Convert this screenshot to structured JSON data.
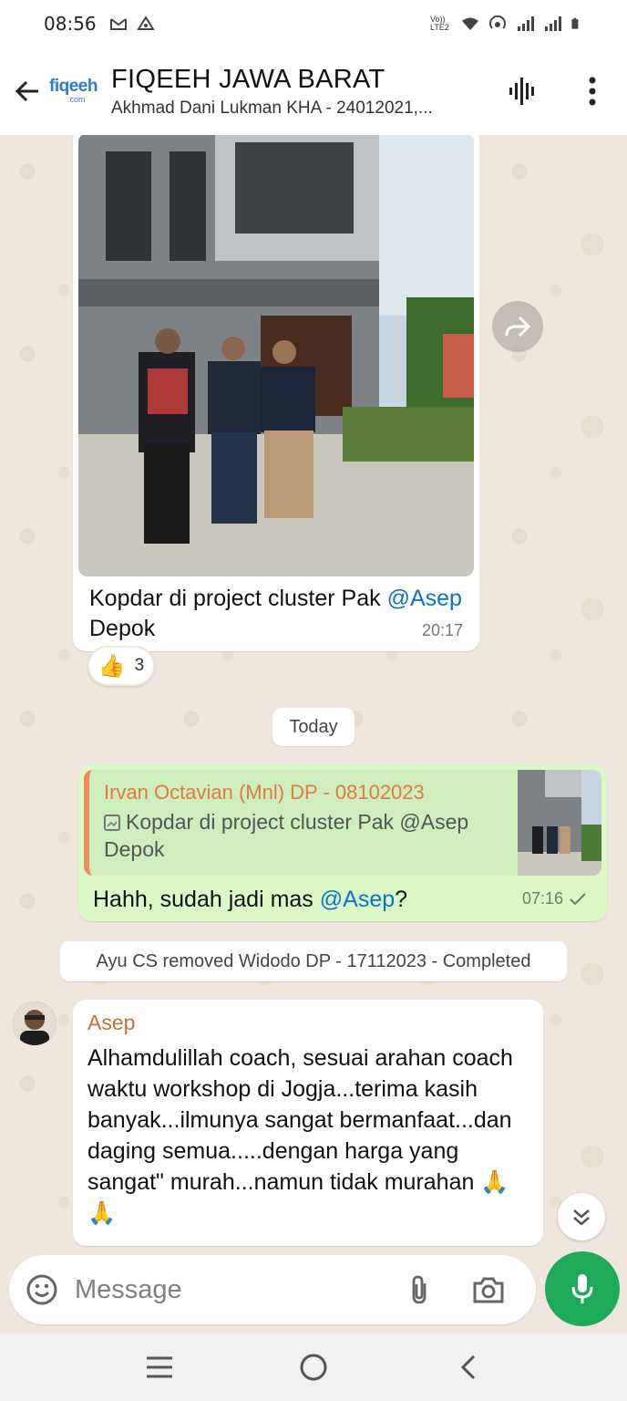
{
  "status_bar": {
    "time": "08:56",
    "left_icons": [
      "gmail-icon",
      "drive-icon"
    ],
    "right_icons": [
      "volte-icon",
      "wifi-icon",
      "hotspot-icon",
      "signal-icon",
      "signal-icon",
      "battery-icon"
    ],
    "volte_label": "Vo)) LTE2"
  },
  "header": {
    "title": "FIQEEH JAWA BARAT",
    "subtitle": "Akhmad Dani Lukman KHA - 24012021,...",
    "logo_text": "fiqeeh",
    "logo_sub": ".com",
    "actions": [
      "voice-chat-icon",
      "more-options-icon"
    ]
  },
  "messages": {
    "photo": {
      "caption_prefix": "Kopdar di project cluster Pak ",
      "caption_mention": "@Asep",
      "caption_suffix": " Depok",
      "time": "20:17",
      "reaction_emoji": "👍",
      "reaction_count": "3"
    },
    "date_divider": "Today",
    "reply": {
      "quoted_author": "Irvan Octavian (Mnl) DP - 08102023",
      "quoted_text": "Kopdar di project cluster Pak @Asep Depok",
      "text_prefix": "Hahh, sudah jadi mas ",
      "text_mention": "@Asep",
      "text_suffix": "?",
      "time": "07:16",
      "status": "sent"
    },
    "system": "Ayu CS removed Widodo DP - 17112023 - Completed",
    "asep": {
      "sender": "Asep",
      "text": "Alhamdulillah coach, sesuai arahan coach waktu workshop di Jogja...terima kasih banyak...ilmunya sangat bermanfaat...dan daging semua.....dengan harga yang sangat\" murah...namun tidak murahan 🙏 🙏"
    }
  },
  "composer": {
    "placeholder": "Message"
  },
  "colors": {
    "accent_green": "#1faa59",
    "outgoing_bubble": "#dcf8c6",
    "mention_blue": "#0b73c9",
    "quote_author": "#e07a45",
    "sender_asep": "#c0703f"
  }
}
